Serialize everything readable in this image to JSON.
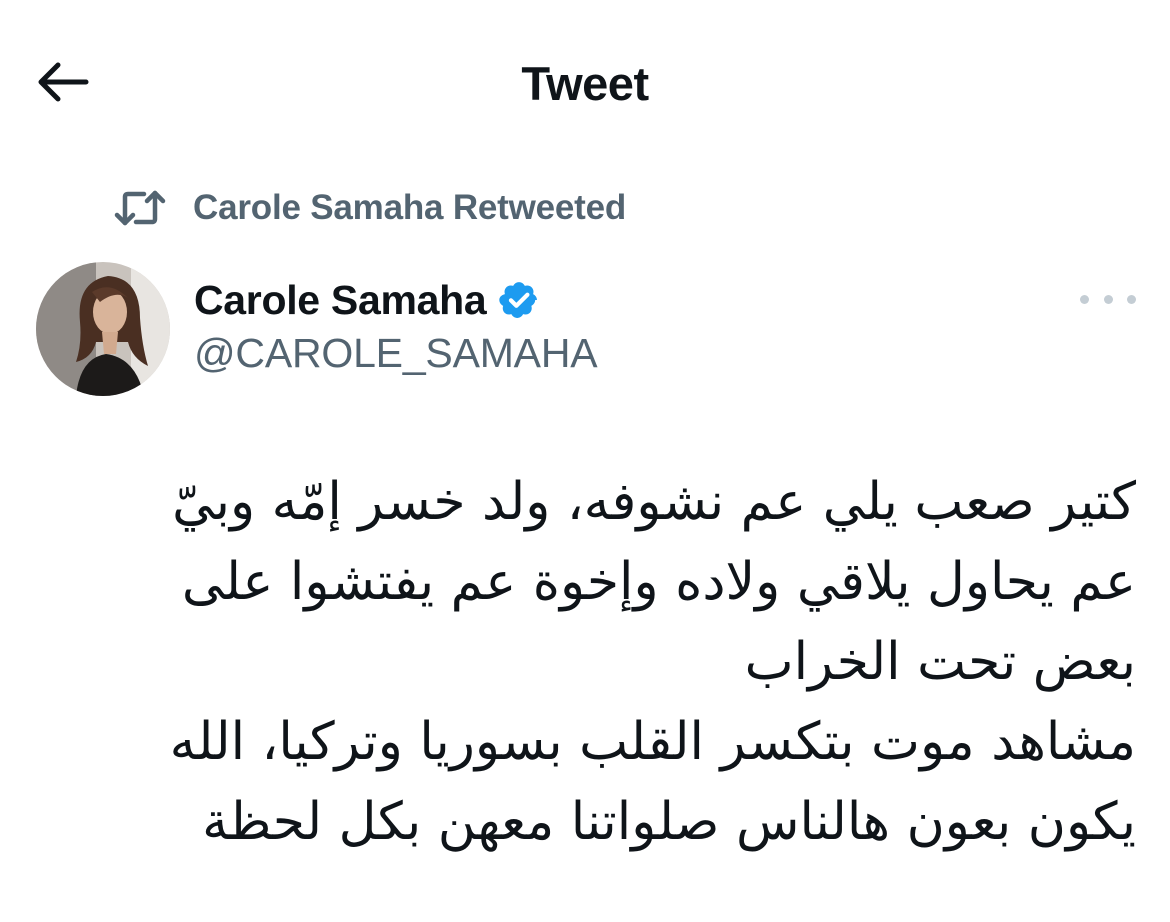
{
  "header": {
    "title": "Tweet",
    "back_icon": "arrow-left-icon"
  },
  "retweet": {
    "icon": "retweet-icon",
    "label": "Carole Samaha Retweeted"
  },
  "author": {
    "name": "Carole Samaha",
    "handle": "@CAROLE_SAMAHA",
    "verified": true,
    "verified_color": "#1d9bf0",
    "more_icon": "more-horizontal-icon"
  },
  "tweet": {
    "lines": [
      "كتير صعب يلي عم نشوفه، ولد خسر إمّه وبيّ",
      "عم يحاول يلاقي ولاده وإخوة عم يفتشوا على",
      "بعض تحت الخراب",
      "مشاهد موت بتكسر القلب بسوريا وتركيا، الله",
      "يكون بعون هالناس صلواتنا معهن بكل لحظة"
    ]
  },
  "colors": {
    "text_primary": "#0f1419",
    "text_secondary": "#536471",
    "accent": "#1d9bf0"
  }
}
